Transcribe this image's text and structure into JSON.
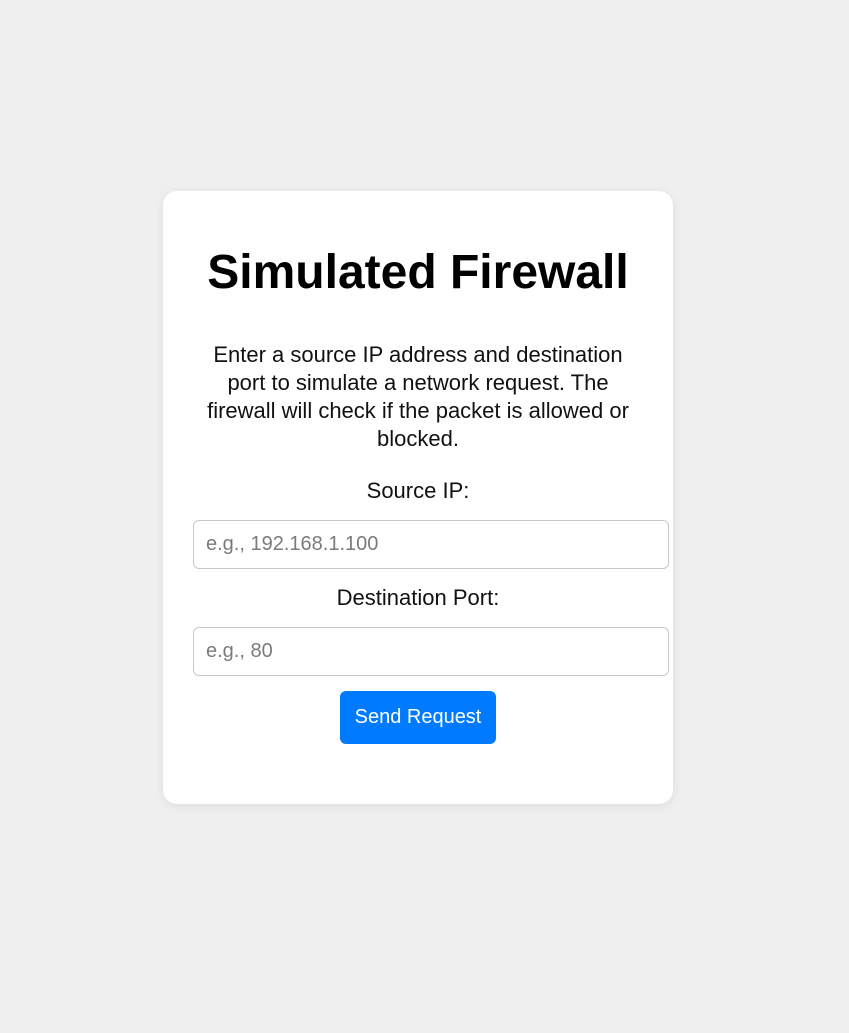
{
  "page": {
    "background_color": "#efefef"
  },
  "card": {
    "title": "Simulated Firewall",
    "description": "Enter a source IP address and destination port to simulate a network request. The firewall will check if the packet is allowed or blocked."
  },
  "form": {
    "source_ip": {
      "label": "Source IP:",
      "placeholder": "e.g., 192.168.1.100",
      "value": ""
    },
    "destination_port": {
      "label": "Destination Port:",
      "placeholder": "e.g., 80",
      "value": ""
    },
    "submit": {
      "label": "Send Request",
      "color": "#007bff"
    }
  }
}
